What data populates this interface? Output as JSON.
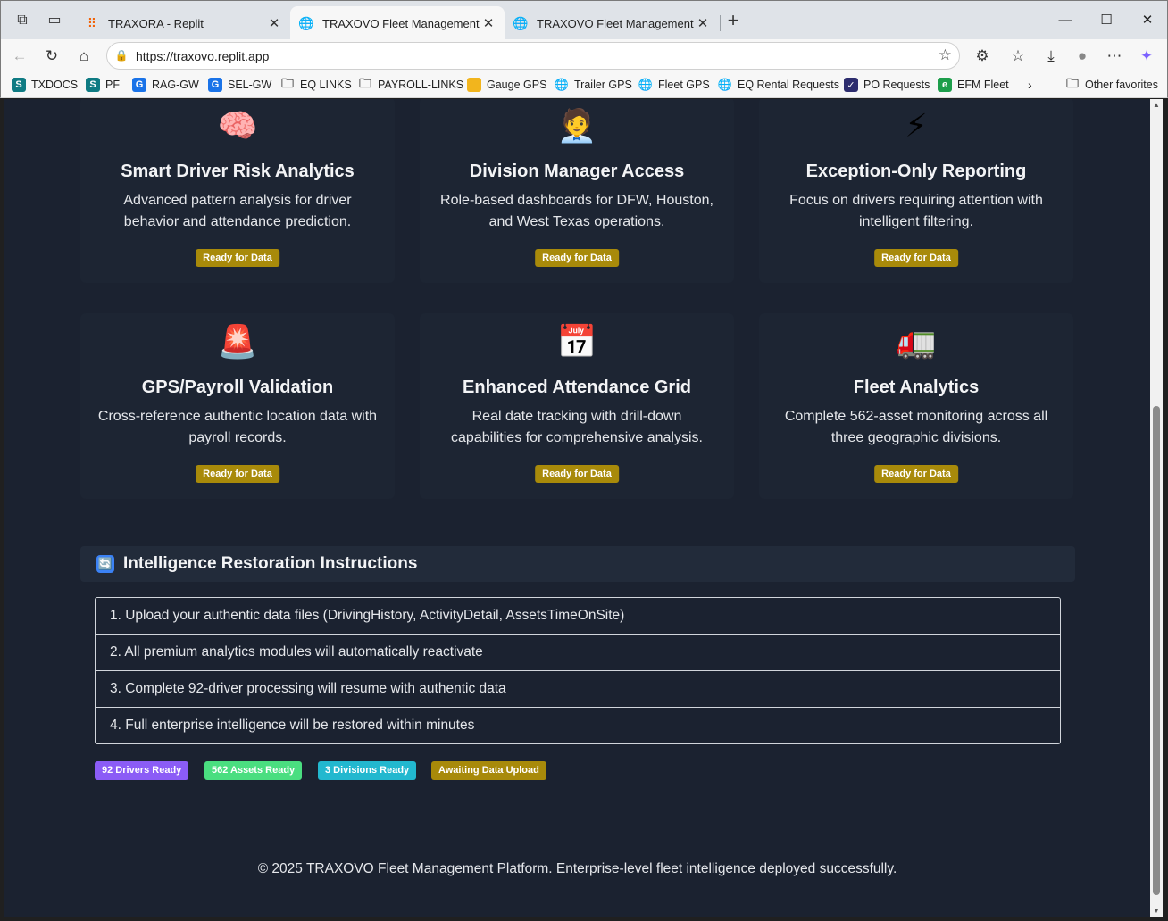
{
  "browser": {
    "tabs": [
      {
        "title": "TRAXORA - Replit",
        "icon": "replit-icon",
        "active": false
      },
      {
        "title": "TRAXOVO Fleet Management",
        "icon": "globe-icon",
        "active": true
      },
      {
        "title": "TRAXOVO Fleet Management",
        "icon": "globe-icon",
        "active": false
      }
    ],
    "new_tab_symbol": "+",
    "url": "https://traxovo.replit.app",
    "bookmarks": [
      {
        "label": "TXDOCS",
        "icon": "sharepoint-icon",
        "color": "#0f7b83"
      },
      {
        "label": "PF",
        "icon": "sharepoint-icon",
        "color": "#0f7b83"
      },
      {
        "label": "RAG-GW",
        "icon": "g-icon",
        "color": "#1a73e8"
      },
      {
        "label": "SEL-GW",
        "icon": "g-icon",
        "color": "#1a73e8"
      },
      {
        "label": "EQ LINKS",
        "icon": "folder-icon",
        "color": "#444444"
      },
      {
        "label": "PAYROLL-LINKS",
        "icon": "folder-icon",
        "color": "#444444"
      },
      {
        "label": "Gauge GPS",
        "icon": "gauge-icon",
        "color": "#f2b51d"
      },
      {
        "label": "Trailer GPS",
        "icon": "globe-icon",
        "color": "#444444"
      },
      {
        "label": "Fleet GPS",
        "icon": "globe-icon",
        "color": "#444444"
      },
      {
        "label": "EQ Rental Requests",
        "icon": "globe-icon",
        "color": "#444444"
      },
      {
        "label": "PO Requests",
        "icon": "check-icon",
        "color": "#2d2d6e"
      },
      {
        "label": "EFM Fleet",
        "icon": "efm-icon",
        "color": "#1d9e4b"
      }
    ],
    "other_favorites": "Other favorites"
  },
  "features": [
    {
      "icon": "🧠",
      "icon_name": "brain-icon",
      "title": "Smart Driver Risk Analytics",
      "desc1": "Advanced pattern analysis for driver",
      "desc2": "behavior and attendance prediction.",
      "badge": "Ready for Data"
    },
    {
      "icon": "🧑‍💼",
      "icon_name": "manager-icon",
      "title": "Division Manager Access",
      "desc1": "Role-based dashboards for DFW, Houston,",
      "desc2": "and West Texas operations.",
      "badge": "Ready for Data"
    },
    {
      "icon": "⚡",
      "icon_name": "lightning-icon",
      "title": "Exception-Only Reporting",
      "desc1": "Focus on drivers requiring attention with",
      "desc2": "intelligent filtering.",
      "badge": "Ready for Data"
    },
    {
      "icon": "🚨",
      "icon_name": "siren-icon",
      "title": "GPS/Payroll Validation",
      "desc1": "Cross-reference authentic location data with",
      "desc2": "payroll records.",
      "badge": "Ready for Data"
    },
    {
      "icon": "📅",
      "icon_name": "calendar-icon",
      "title": "Enhanced Attendance Grid",
      "desc1": "Real date tracking with drill-down",
      "desc2": "capabilities for comprehensive analysis.",
      "badge": "Ready for Data"
    },
    {
      "icon": "🚛",
      "icon_name": "truck-icon",
      "title": "Fleet Analytics",
      "desc1": "Complete 562-asset monitoring across all",
      "desc2": "three geographic divisions.",
      "badge": "Ready for Data"
    }
  ],
  "restoration": {
    "icon": "🔄",
    "title": "Intelligence Restoration Instructions",
    "steps": [
      "1. Upload your authentic data files (DrivingHistory, ActivityDetail, AssetsTimeOnSite)",
      "2. All premium analytics modules will automatically reactivate",
      "3. Complete 92-driver processing will resume with authentic data",
      "4. Full enterprise intelligence will be restored within minutes"
    ],
    "pills": [
      {
        "label": "92 Drivers Ready",
        "color": "#8b5cf6"
      },
      {
        "label": "562 Assets Ready",
        "color": "#4ade80"
      },
      {
        "label": "3 Divisions Ready",
        "color": "#22b8cf"
      },
      {
        "label": "Awaiting Data Upload",
        "color": "#a88a0a"
      }
    ]
  },
  "footer": "© 2025 TRAXOVO Fleet Management Platform. Enterprise-level fleet intelligence deployed successfully."
}
